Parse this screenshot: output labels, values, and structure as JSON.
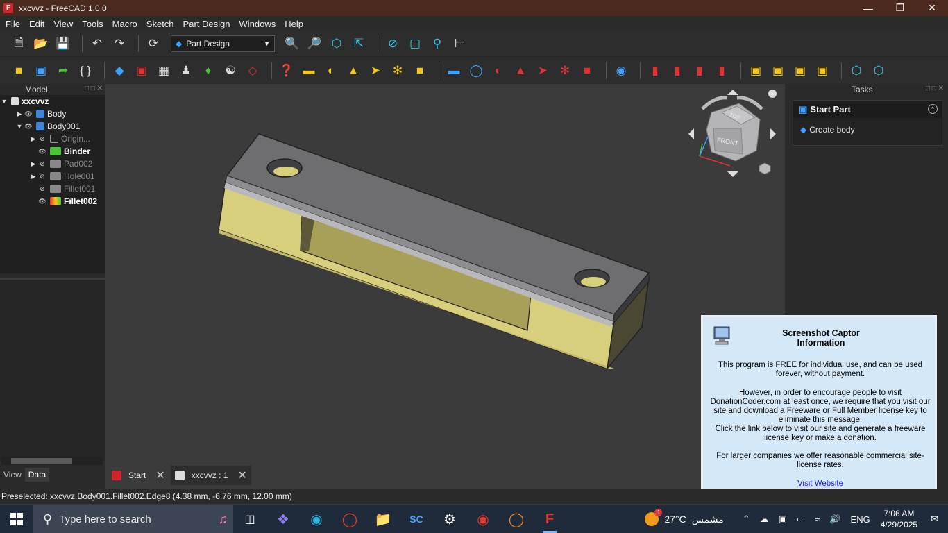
{
  "window": {
    "title": "xxcvvz - FreeCAD 1.0.0",
    "app_icon": "F"
  },
  "menu": {
    "items": [
      "File",
      "Edit",
      "View",
      "Tools",
      "Macro",
      "Sketch",
      "Part Design",
      "Windows",
      "Help"
    ]
  },
  "workbench": {
    "selected": "Part Design"
  },
  "model_panel": {
    "title": "Model",
    "tree": [
      {
        "label": "xxcvvz",
        "icon": "document-icon"
      },
      {
        "label": "Body",
        "icon": "body-icon"
      },
      {
        "label": "Body001",
        "icon": "body-icon"
      },
      {
        "label": "Origin...",
        "icon": "origin-icon"
      },
      {
        "label": "Binder",
        "icon": "binder-icon"
      },
      {
        "label": "Pad002",
        "icon": "pad-icon"
      },
      {
        "label": "Hole001",
        "icon": "hole-icon"
      },
      {
        "label": "Fillet001",
        "icon": "fillet-icon"
      },
      {
        "label": "Fillet002",
        "icon": "fillet-icon"
      }
    ],
    "tabs": {
      "view": "View",
      "data": "Data"
    }
  },
  "navcube": {
    "top": "TOP",
    "front": "FRONT"
  },
  "doc_tabs": {
    "start": "Start",
    "doc": "xxcvvz : 1"
  },
  "tasks_panel": {
    "title": "Tasks",
    "section": "Start Part",
    "action": "Create body"
  },
  "captor": {
    "title_line1": "Screenshot Captor",
    "title_line2": "Information",
    "p1": "This program is FREE for individual use, and can be used forever, without payment.",
    "p2": "However, in order to encourage people to visit DonationCoder.com at least once, we require that you visit our site and download a Freeware or Full Member license key to eliminate this message.",
    "p3": "Click the link below to visit our site and generate a freeware license key or make a donation.",
    "p4": "For larger companies we offer reasonable commercial site-license rates.",
    "link": "Visit Website"
  },
  "status": {
    "text": "Preselected: xxcvvz.Body001.Fillet002.Edge8 (4.38 mm, -6.76 mm, 12.00 mm)"
  },
  "taskbar": {
    "search_placeholder": "Type here to search",
    "weather_temp": "27°C",
    "weather_text": "مشمس",
    "weather_badge": "1",
    "language": "ENG",
    "time": "7:06 AM",
    "date": "4/29/2025"
  },
  "colors": {
    "part_top": "#6e6e70",
    "part_body": "#d8cf7c",
    "dialog_bg": "#d4e8f8",
    "title_bar": "#4a2a1f"
  }
}
